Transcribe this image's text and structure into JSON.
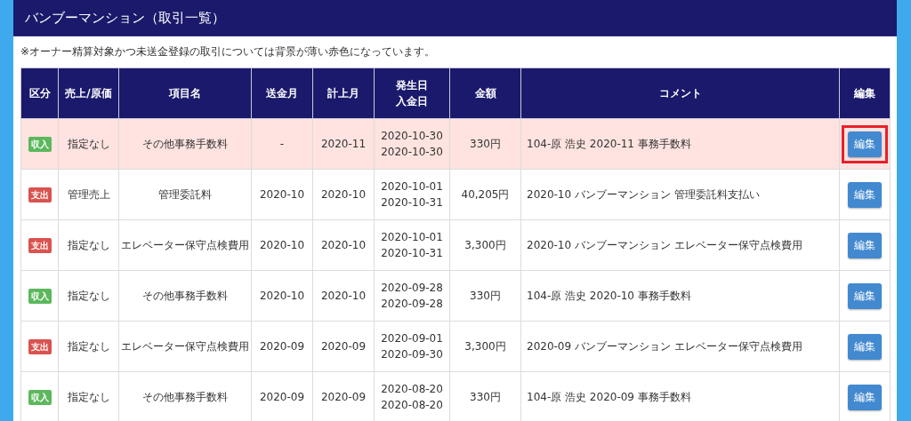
{
  "title": "バンブーマンション（取引一覧）",
  "note": "※オーナー精算対象かつ未送金登録の取引については背景が薄い赤色になっています。",
  "table": {
    "columns": [
      [
        "区分"
      ],
      [
        "売上/原価"
      ],
      [
        "項目名"
      ],
      [
        "送金月"
      ],
      [
        "計上月"
      ],
      [
        "発生日",
        "入金日"
      ],
      [
        "金額"
      ],
      [
        "コメント"
      ],
      [
        "編集"
      ]
    ],
    "rows": [
      {
        "unsent": true,
        "category": {
          "kind": "income",
          "label": "収入"
        },
        "type": "指定なし",
        "item": "その他事務手数料",
        "remit_month": "-",
        "book_month": "2020-11",
        "dates": [
          "2020-10-30",
          "2020-10-30"
        ],
        "amount": "330円",
        "comment": "104-原 浩史 2020-11 事務手数料",
        "edit": {
          "label": "編集",
          "highlighted": true
        }
      },
      {
        "unsent": false,
        "category": {
          "kind": "expense",
          "label": "支出"
        },
        "type": "管理売上",
        "item": "管理委託料",
        "remit_month": "2020-10",
        "book_month": "2020-10",
        "dates": [
          "2020-10-01",
          "2020-10-31"
        ],
        "amount": "40,205円",
        "comment": "2020-10 バンブーマンション 管理委託料支払い",
        "edit": {
          "label": "編集",
          "highlighted": false
        }
      },
      {
        "unsent": false,
        "category": {
          "kind": "expense",
          "label": "支出"
        },
        "type": "指定なし",
        "item": "エレベーター保守点検費用",
        "remit_month": "2020-10",
        "book_month": "2020-10",
        "dates": [
          "2020-10-01",
          "2020-10-31"
        ],
        "amount": "3,300円",
        "comment": "2020-10 バンブーマンション エレベーター保守点検費用",
        "edit": {
          "label": "編集",
          "highlighted": false
        }
      },
      {
        "unsent": false,
        "category": {
          "kind": "income",
          "label": "収入"
        },
        "type": "指定なし",
        "item": "その他事務手数料",
        "remit_month": "2020-10",
        "book_month": "2020-10",
        "dates": [
          "2020-09-28",
          "2020-09-28"
        ],
        "amount": "330円",
        "comment": "104-原 浩史 2020-10 事務手数料",
        "edit": {
          "label": "編集",
          "highlighted": false
        }
      },
      {
        "unsent": false,
        "category": {
          "kind": "expense",
          "label": "支出"
        },
        "type": "指定なし",
        "item": "エレベーター保守点検費用",
        "remit_month": "2020-09",
        "book_month": "2020-09",
        "dates": [
          "2020-09-01",
          "2020-09-30"
        ],
        "amount": "3,300円",
        "comment": "2020-09 バンブーマンション エレベーター保守点検費用",
        "edit": {
          "label": "編集",
          "highlighted": false
        }
      },
      {
        "unsent": false,
        "category": {
          "kind": "income",
          "label": "収入"
        },
        "type": "指定なし",
        "item": "その他事務手数料",
        "remit_month": "2020-09",
        "book_month": "2020-09",
        "dates": [
          "2020-08-20",
          "2020-08-20"
        ],
        "amount": "330円",
        "comment": "104-原 浩史 2020-09 事務手数料",
        "edit": {
          "label": "編集",
          "highlighted": false
        }
      }
    ]
  }
}
